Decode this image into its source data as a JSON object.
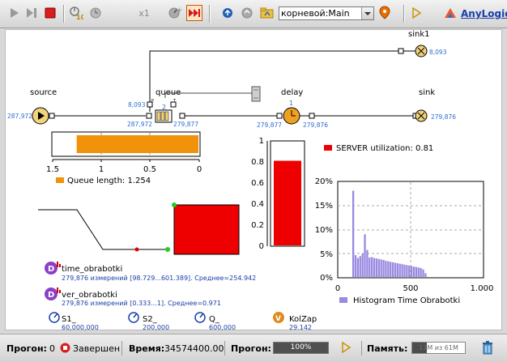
{
  "toolbar": {
    "speed_label": "x1",
    "agent_selector": "корневой:Main",
    "brand": "AnyLogic"
  },
  "model": {
    "blocks": {
      "source": {
        "label": "source",
        "count": "287,972"
      },
      "queue": {
        "label": "queue",
        "count_in": "287,972",
        "count_out": "279,877",
        "count_top": "8,093",
        "capacity": "2",
        "port_p": "P",
        "port_t": "T"
      },
      "delay": {
        "label": "delay",
        "count_in": "279,877",
        "count_out": "279,876",
        "capacity": "1"
      },
      "sink": {
        "label": "sink",
        "count": "279,876"
      },
      "sink1": {
        "label": "sink1",
        "count": "8,093"
      }
    },
    "queue_chart": {
      "type": "bar",
      "axis_ticks": [
        "1.5",
        "1",
        "0.5",
        "0"
      ],
      "xlim": [
        1.5,
        0
      ],
      "value": 1.254,
      "legend": "Queue length: 1.254",
      "color": "#f0920a"
    },
    "util_chart": {
      "type": "bar",
      "axis_ticks": [
        "1",
        "0.8",
        "0.6",
        "0.4",
        "0.2",
        "0"
      ],
      "ylim": [
        0,
        1
      ],
      "value": 0.81,
      "legend": "SERVER utilization: 0.81",
      "color": "#ee0000"
    },
    "datasets": [
      {
        "icon": "D",
        "name": "time_obrabotki",
        "summary": "279,876 измерений [98.729...601.389]. Среднее=254.942"
      },
      {
        "icon": "D",
        "name": "ver_obrabotki",
        "summary": "279,876 измерений [0.333...1]. Среднее=0.971"
      }
    ],
    "params": [
      {
        "name": "S1_",
        "value": "60,000,000"
      },
      {
        "name": "S2_",
        "value": "200,000"
      },
      {
        "name": "Q_",
        "value": "600,000"
      }
    ],
    "variable": {
      "icon": "V",
      "name": "KolZap",
      "value": "29.142"
    }
  },
  "chart_data": {
    "type": "bar",
    "title": "Histogram Time Obrabotki",
    "legend": "Histogram Time Obrabotki",
    "xlim": [
      0,
      1000
    ],
    "ylim": [
      0,
      20
    ],
    "x_ticks": [
      "0",
      "500",
      "1.000"
    ],
    "y_ticks": [
      "0%",
      "5%",
      "10%",
      "15%",
      "20%"
    ],
    "grid": true,
    "color": "#9a88e0",
    "bin_width": 16,
    "x": [
      100,
      116,
      132,
      148,
      164,
      180,
      196,
      212,
      228,
      244,
      260,
      276,
      292,
      308,
      324,
      340,
      356,
      372,
      388,
      404,
      420,
      436,
      452,
      468,
      484,
      500,
      516,
      532,
      548,
      564,
      580,
      596
    ],
    "values": [
      18.2,
      4.6,
      4.0,
      4.4,
      4.9,
      9.0,
      5.7,
      4.1,
      4.2,
      4.0,
      3.9,
      3.8,
      3.7,
      3.6,
      3.4,
      3.3,
      3.2,
      3.1,
      3.0,
      2.9,
      2.8,
      2.7,
      2.6,
      2.5,
      2.4,
      2.3,
      2.2,
      2.1,
      2.0,
      1.9,
      1.6,
      0.8
    ]
  },
  "status": {
    "run_label": "Прогон:",
    "run_value": "0",
    "state": "Завершен",
    "time_label": "Время:",
    "time_value": "34574400.00",
    "progress_label": "Прогон:",
    "progress_value": "100%",
    "progress_fraction": 1.0,
    "memory_label": "Память:",
    "memory_value": "17M из 61M",
    "memory_fraction": 0.28
  }
}
